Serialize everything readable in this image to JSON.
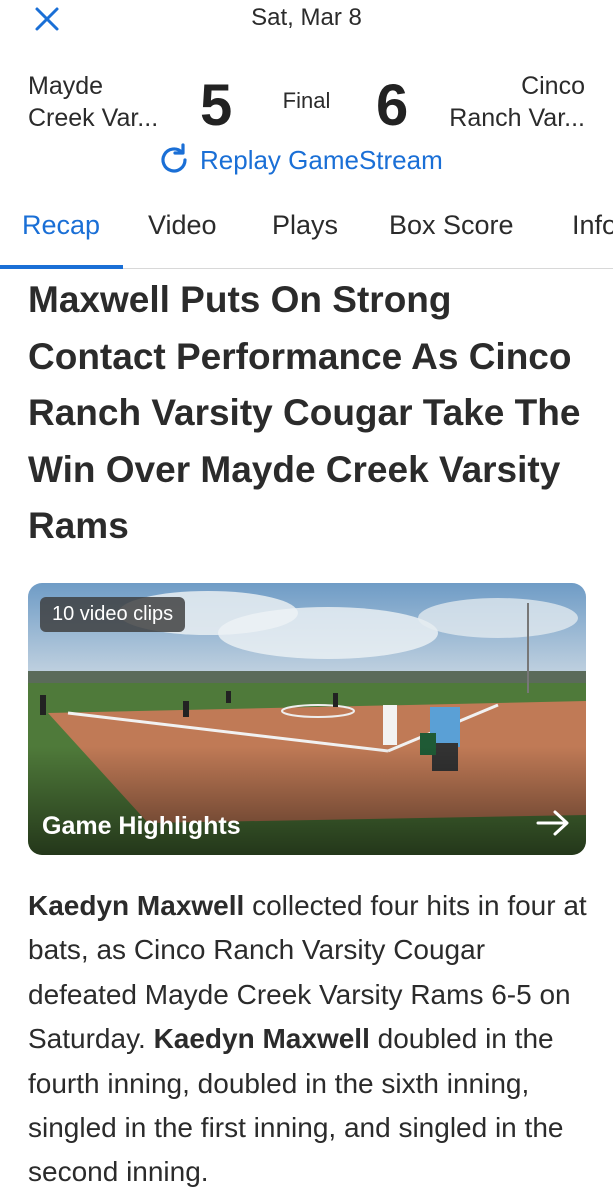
{
  "header": {
    "date": "Sat, Mar 8",
    "close_icon": "close-icon"
  },
  "game": {
    "away_team": [
      "Mayde",
      "Creek Var..."
    ],
    "away_score": "5",
    "status": "Final",
    "home_score": "6",
    "home_team": [
      "Cinco",
      "Ranch Var..."
    ],
    "replay_label": "Replay GameStream",
    "accent_color": "#1a6fd6"
  },
  "tabs": [
    {
      "label": "Recap",
      "active": true
    },
    {
      "label": "Video",
      "active": false
    },
    {
      "label": "Plays",
      "active": false
    },
    {
      "label": "Box Score",
      "active": false
    },
    {
      "label": "Info",
      "active": false
    }
  ],
  "article": {
    "headline": "Maxwell Puts On Strong Contact Performance As Cinco Ranch Varsity Cougar Take The Win Over Mayde Creek Varsity Rams",
    "video": {
      "clips_badge": "10 video clips",
      "title": "Game Highlights",
      "arrow_icon": "arrow-right-icon"
    },
    "recap": {
      "player": "Kaedyn Maxwell",
      "text1": " collected four hits in four at bats, as Cinco Ranch Varsity Cougar defeated Mayde Creek Varsity Rams 6-5 on Saturday. ",
      "player2": "Kaedyn Maxwell",
      "text2": " doubled in the fourth inning, doubled in the sixth inning, singled in the first inning, and singled in the second inning."
    }
  }
}
